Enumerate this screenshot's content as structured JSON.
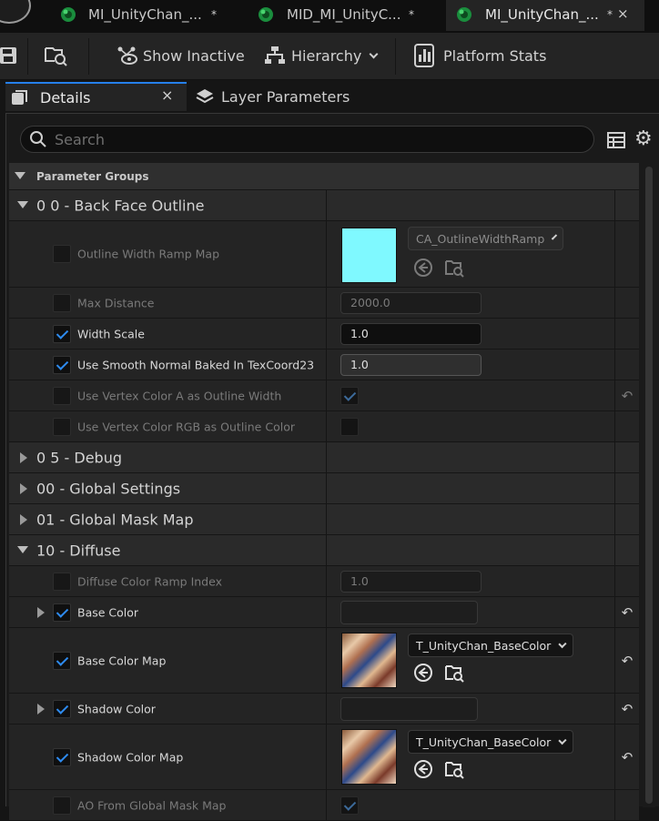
{
  "tabs": [
    {
      "title": "MI_UnityChan_...",
      "modified": "*"
    },
    {
      "title": "MID_MI_UnityC...",
      "modified": "*"
    },
    {
      "title": "MI_UnityChan_...",
      "modified": "*",
      "close": "×"
    }
  ],
  "toolbar": {
    "show_inactive": "Show Inactive",
    "hierarchy": "Hierarchy",
    "platform_stats": "Platform Stats"
  },
  "panel_tabs": {
    "details": "Details",
    "details_close": "×",
    "layer_parameters": "Layer Parameters"
  },
  "search": {
    "placeholder": "Search"
  },
  "parameter_groups": "Parameter Groups",
  "categories": {
    "back_face_outline": "0 0 - Back Face Outline",
    "debug": "0 5 - Debug",
    "global_settings": "00 - Global Settings",
    "global_mask_map": "01 - Global Mask Map",
    "diffuse": "10 - Diffuse"
  },
  "outline": {
    "width_ramp_map": {
      "label": "Outline Width Ramp Map",
      "asset": "CA_OutlineWidthRamp",
      "enabled": false,
      "swatch": "#7ff9ff"
    },
    "max_distance": {
      "label": "Max Distance",
      "value": "2000.0",
      "enabled": false
    },
    "width_scale": {
      "label": "Width Scale",
      "value": "1.0",
      "enabled": true
    },
    "smooth_normal": {
      "label": "Use Smooth Normal Baked In TexCoord23",
      "value": "1.0",
      "enabled": true
    },
    "vertex_color_a": {
      "label": "Use Vertex Color A as Outline Width",
      "enabled": false,
      "value_checked": true
    },
    "vertex_color_rgb": {
      "label": "Use Vertex Color RGB as Outline Color",
      "enabled": false,
      "value_checked": false
    }
  },
  "diffuse": {
    "ramp_index": {
      "label": "Diffuse Color Ramp Index",
      "value": "1.0",
      "enabled": false
    },
    "base_color": {
      "label": "Base Color",
      "enabled": true
    },
    "base_color_map": {
      "label": "Base Color Map",
      "asset": "T_UnityChan_BaseColor",
      "enabled": true
    },
    "shadow_color": {
      "label": "Shadow Color",
      "enabled": true
    },
    "shadow_color_map": {
      "label": "Shadow Color Map",
      "asset": "T_UnityChan_BaseColor",
      "enabled": true
    },
    "ao_global_mask": {
      "label": "AO From Global Mask Map",
      "enabled": false,
      "value_checked": true
    }
  },
  "colors": {
    "accent": "#2680eb",
    "check": "#2e8bf0",
    "asset_green": "#1fa84a"
  }
}
